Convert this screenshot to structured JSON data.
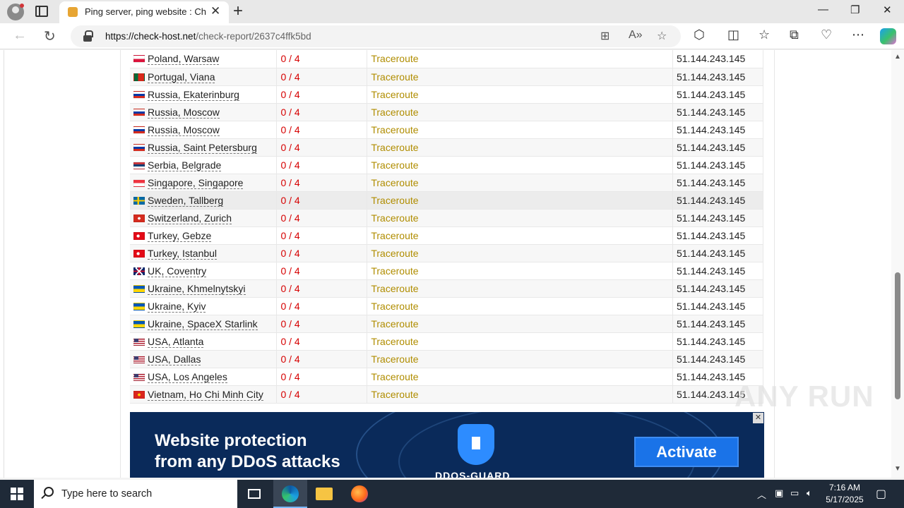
{
  "browser": {
    "tab_title": "Ping server, ping website : Check",
    "url_host": "https://check-host.net",
    "url_path": "/check-report/2637c4ffk5bd"
  },
  "rows": [
    {
      "location": "Poland, Warsaw",
      "result": "0 / 4",
      "action": "Traceroute",
      "ip": "51.144.243.145",
      "flag": "pl"
    },
    {
      "location": "Portugal, Viana",
      "result": "0 / 4",
      "action": "Traceroute",
      "ip": "51.144.243.145",
      "flag": "pt"
    },
    {
      "location": "Russia, Ekaterinburg",
      "result": "0 / 4",
      "action": "Traceroute",
      "ip": "51.144.243.145",
      "flag": "ru"
    },
    {
      "location": "Russia, Moscow",
      "result": "0 / 4",
      "action": "Traceroute",
      "ip": "51.144.243.145",
      "flag": "ru"
    },
    {
      "location": "Russia, Moscow",
      "result": "0 / 4",
      "action": "Traceroute",
      "ip": "51.144.243.145",
      "flag": "ru"
    },
    {
      "location": "Russia, Saint Petersburg",
      "result": "0 / 4",
      "action": "Traceroute",
      "ip": "51.144.243.145",
      "flag": "ru"
    },
    {
      "location": "Serbia, Belgrade",
      "result": "0 / 4",
      "action": "Traceroute",
      "ip": "51.144.243.145",
      "flag": "rs"
    },
    {
      "location": "Singapore, Singapore",
      "result": "0 / 4",
      "action": "Traceroute",
      "ip": "51.144.243.145",
      "flag": "sg"
    },
    {
      "location": "Sweden, Tallberg",
      "result": "0 / 4",
      "action": "Traceroute",
      "ip": "51.144.243.145",
      "flag": "se"
    },
    {
      "location": "Switzerland, Zurich",
      "result": "0 / 4",
      "action": "Traceroute",
      "ip": "51.144.243.145",
      "flag": "ch"
    },
    {
      "location": "Turkey, Gebze",
      "result": "0 / 4",
      "action": "Traceroute",
      "ip": "51.144.243.145",
      "flag": "tr"
    },
    {
      "location": "Turkey, Istanbul",
      "result": "0 / 4",
      "action": "Traceroute",
      "ip": "51.144.243.145",
      "flag": "tr"
    },
    {
      "location": "UK, Coventry",
      "result": "0 / 4",
      "action": "Traceroute",
      "ip": "51.144.243.145",
      "flag": "gb"
    },
    {
      "location": "Ukraine, Khmelnytskyi",
      "result": "0 / 4",
      "action": "Traceroute",
      "ip": "51.144.243.145",
      "flag": "ua"
    },
    {
      "location": "Ukraine, Kyiv",
      "result": "0 / 4",
      "action": "Traceroute",
      "ip": "51.144.243.145",
      "flag": "ua"
    },
    {
      "location": "Ukraine, SpaceX Starlink",
      "result": "0 / 4",
      "action": "Traceroute",
      "ip": "51.144.243.145",
      "flag": "ua"
    },
    {
      "location": "USA, Atlanta",
      "result": "0 / 4",
      "action": "Traceroute",
      "ip": "51.144.243.145",
      "flag": "us"
    },
    {
      "location": "USA, Dallas",
      "result": "0 / 4",
      "action": "Traceroute",
      "ip": "51.144.243.145",
      "flag": "us"
    },
    {
      "location": "USA, Los Angeles",
      "result": "0 / 4",
      "action": "Traceroute",
      "ip": "51.144.243.145",
      "flag": "us"
    },
    {
      "location": "Vietnam, Ho Chi Minh City",
      "result": "0 / 4",
      "action": "Traceroute",
      "ip": "51.144.243.145",
      "flag": "vn"
    }
  ],
  "ad": {
    "line1": "Website protection",
    "line2": "from any DDoS attacks",
    "button": "Activate",
    "brand": "DDOS-GUARD",
    "close": "✕"
  },
  "watermark": "ANY RUN",
  "taskbar": {
    "search_placeholder": "Type here to search",
    "time": "7:16 AM",
    "date": "5/17/2025"
  },
  "colors": {
    "result_red": "#d60000",
    "traceroute_gold": "#b08d00",
    "ad_bg": "#0a2a5a",
    "ad_button": "#1a73e8"
  }
}
